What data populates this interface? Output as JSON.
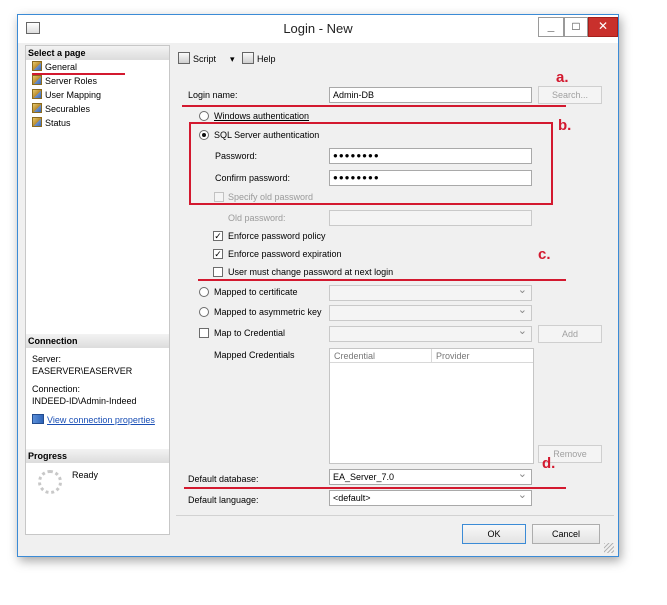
{
  "window": {
    "title": "Login - New",
    "minimize_glyph": "_",
    "maximize_glyph": "□",
    "close_glyph": "✕"
  },
  "sidebar": {
    "select_header": "Select a page",
    "items": [
      {
        "label": "General"
      },
      {
        "label": "Server Roles"
      },
      {
        "label": "User Mapping"
      },
      {
        "label": "Securables"
      },
      {
        "label": "Status"
      }
    ],
    "connection_header": "Connection",
    "server_label": "Server:",
    "server_value": "EASERVER\\EASERVER",
    "connection_label": "Connection:",
    "connection_value": "INDEED-ID\\Admin-Indeed",
    "view_link": "View connection properties",
    "progress_header": "Progress",
    "progress_status": "Ready"
  },
  "toolbar": {
    "script_label": "Script",
    "help_label": "Help"
  },
  "form": {
    "login_name_label": "Login name:",
    "login_name_value": "Admin-DB",
    "search_button": "Search...",
    "windows_auth": "Windows authentication",
    "sql_auth": "SQL Server authentication",
    "password_label": "Password:",
    "password_value": "●●●●●●●●",
    "confirm_label": "Confirm password:",
    "confirm_value": "●●●●●●●●",
    "specify_old": "Specify old password",
    "old_password_label": "Old password:",
    "enforce_policy": "Enforce password policy",
    "enforce_expiration": "Enforce password expiration",
    "must_change": "User must change password at next login",
    "mapped_certificate": "Mapped to certificate",
    "mapped_asymmetric": "Mapped to asymmetric key",
    "map_credential": "Map to Credential",
    "add_button": "Add",
    "mapped_credentials_label": "Mapped Credentials",
    "grid_col_credential": "Credential",
    "grid_col_provider": "Provider",
    "remove_button": "Remove",
    "default_db_label": "Default database:",
    "default_db_value": "EA_Server_7.0",
    "default_lang_label": "Default language:",
    "default_lang_value": "<default>",
    "check_mark": "✓"
  },
  "footer": {
    "ok_button": "OK",
    "cancel_button": "Cancel"
  },
  "annotations": {
    "a": "a.",
    "b": "b.",
    "c": "c.",
    "d": "d."
  },
  "colors": {
    "annotation_red": "#d3192f",
    "window_border": "#3b8bd6",
    "link_blue": "#1a4fb5"
  }
}
